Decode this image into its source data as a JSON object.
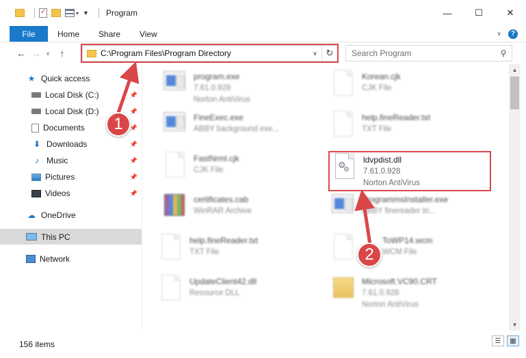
{
  "window": {
    "title": "Program",
    "minimize_icon": "—",
    "maximize_icon": "☐",
    "close_icon": "✕"
  },
  "quick_access_toolbar": {
    "customize_glyph": "▼",
    "view_dropdown_glyph": "▾"
  },
  "ribbon": {
    "tabs": [
      "File",
      "Home",
      "Share",
      "View"
    ],
    "help_glyph": "?",
    "collapse_glyph": "∨"
  },
  "navigation": {
    "back_glyph": "←",
    "forward_glyph": "→",
    "recent_glyph": "∨",
    "up_glyph": "↑",
    "address": "C:\\Program Files\\Program Directory",
    "address_dropdown_glyph": "∨",
    "refresh_glyph": "↻",
    "search_placeholder": "Search Program",
    "search_glyph": "⚲"
  },
  "sidebar": {
    "pin_glyph": "📌",
    "items": [
      {
        "label": "Quick access",
        "icon": "star-icon",
        "glyph": "★",
        "pinned": false
      },
      {
        "label": "Local Disk (C:)",
        "icon": "drive-icon",
        "glyph": "",
        "pinned": true
      },
      {
        "label": "Local Disk (D:)",
        "icon": "drive-icon",
        "glyph": "",
        "pinned": true
      },
      {
        "label": "Documents",
        "icon": "documents-icon",
        "glyph": "",
        "pinned": true
      },
      {
        "label": "Downloads",
        "icon": "download-arrow-icon",
        "glyph": "⬇",
        "pinned": true
      },
      {
        "label": "Music",
        "icon": "music-note-icon",
        "glyph": "♪",
        "pinned": true
      },
      {
        "label": "Pictures",
        "icon": "pictures-icon",
        "glyph": "",
        "pinned": true
      },
      {
        "label": "Videos",
        "icon": "videos-icon",
        "glyph": "",
        "pinned": true
      },
      {
        "label": "OneDrive",
        "icon": "cloud-icon",
        "glyph": "☁",
        "pinned": false
      },
      {
        "label": "This PC",
        "icon": "computer-icon",
        "glyph": "",
        "pinned": false,
        "selected": true
      },
      {
        "label": "Network",
        "icon": "network-icon",
        "glyph": "",
        "pinned": false
      }
    ]
  },
  "files": [
    {
      "name": "program.exe",
      "line1": "7.61.0.928",
      "line2": "Norton AntiVirus",
      "icon": "exe-icon"
    },
    {
      "name": "Korean.cjk",
      "line1": "CJK File",
      "line2": "",
      "icon": "blank-file-icon"
    },
    {
      "name": "FineExec.exe",
      "line1": "ABBY background exe...",
      "line2": "",
      "icon": "exe-icon"
    },
    {
      "name": "help.fineReader.txt",
      "line1": "TXT File",
      "line2": "",
      "icon": "blank-file-icon"
    },
    {
      "name": "FastNrml.cjk",
      "line1": "CJK File",
      "line2": "",
      "icon": "blank-file-icon"
    },
    {
      "name": "ldvpdist.dll",
      "line1": "7.61.0.928",
      "line2": "Norton AntiVirus",
      "icon": "dll-gear-icon"
    },
    {
      "name": "certificates.cab",
      "line1": "WinRAR Archive",
      "line2": "",
      "icon": "winrar-archive-icon"
    },
    {
      "name": "ProgrammsInstaller.exe",
      "line1": "ABBY finereader tri...",
      "line2": "",
      "icon": "exe-icon"
    },
    {
      "name": "help.fineReader.txt",
      "line1": "TXT File",
      "line2": "",
      "icon": "blank-file-icon"
    },
    {
      "name": "ToWP14.wcm",
      "line1": "WCM File",
      "line2": "",
      "icon": "blank-file-icon"
    },
    {
      "name": "UpdateClient42.dll",
      "line1": "Resource DLL",
      "line2": "",
      "icon": "blank-file-icon"
    },
    {
      "name": "Microsoft.VC90.CRT",
      "line1": "7.61.0.928",
      "line2": "Norton AntiVirus",
      "icon": "folder-icon"
    }
  ],
  "status": {
    "items_count": "156 items",
    "details_view_glyph": "☰",
    "large_icons_view_glyph": "▦"
  },
  "annotations": {
    "step1": "1",
    "step2": "2",
    "color": "#d9474a"
  },
  "colors": {
    "accent": "#1979ca",
    "selection": "#d9d9d9"
  }
}
